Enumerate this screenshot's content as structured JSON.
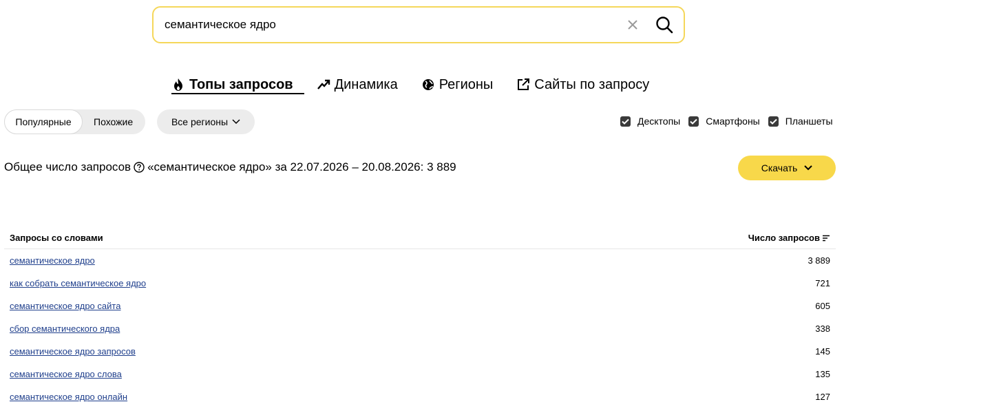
{
  "search": {
    "query": "семантическое ядро"
  },
  "tabs": [
    {
      "label": "Топы запросов",
      "icon": "fire-icon",
      "active": true
    },
    {
      "label": "Динамика",
      "icon": "trend-up-icon"
    },
    {
      "label": "Регионы",
      "icon": "globe-icon"
    },
    {
      "label": "Сайты по запросу",
      "icon": "external-link-icon"
    }
  ],
  "filters": {
    "segment": {
      "selected": "Популярные",
      "other": "Похожие"
    },
    "regions_label": "Все регионы",
    "devices": [
      {
        "label": "Десктопы",
        "checked": true
      },
      {
        "label": "Смартфоны",
        "checked": true
      },
      {
        "label": "Планшеты",
        "checked": true
      }
    ]
  },
  "summary": {
    "prefix": "Общее число запросов",
    "rest": "«семантическое ядро» за 22.07.2026 – 20.08.2026: 3 889"
  },
  "download_label": "Скачать",
  "table": {
    "headers": {
      "words": "Запросы со словами",
      "count": "Число запросов"
    },
    "rows": [
      {
        "query": "семантическое ядро",
        "count": "3 889"
      },
      {
        "query": "как собрать семантическое ядро",
        "count": "721"
      },
      {
        "query": "семантическое ядро сайта",
        "count": "605"
      },
      {
        "query": "сбор семантического ядра",
        "count": "338"
      },
      {
        "query": "семантическое ядро запросов",
        "count": "145"
      },
      {
        "query": "семантическое ядро слова",
        "count": "135"
      },
      {
        "query": "семантическое ядро онлайн",
        "count": "127"
      }
    ]
  },
  "colors": {
    "accent_yellow": "#f8d84a",
    "search_border": "#f5d75a",
    "link": "#1f3f8c"
  }
}
